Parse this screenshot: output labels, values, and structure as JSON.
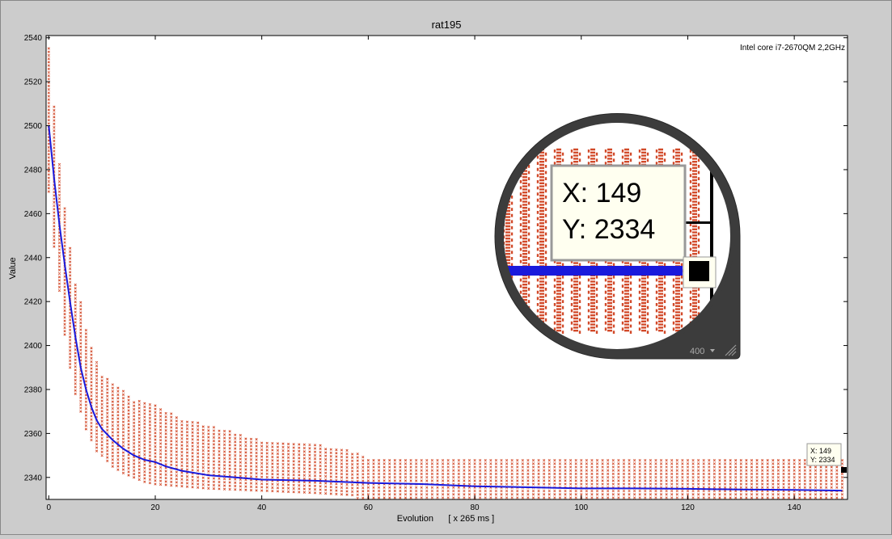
{
  "window": {
    "background": "#cccccc"
  },
  "annotation": {
    "text": "Intel core i7-2670QM 2,2GHz"
  },
  "datatip": {
    "x_label": "X: 149",
    "y_label": "Y: 2334"
  },
  "magnifier": {
    "x_label": "X: 149",
    "y_label": "Y: 2334",
    "zoom": "400"
  },
  "colors": {
    "mean_line": "#1a1adc",
    "samples": "#d24a2a",
    "axes": "#000000",
    "plot_bg": "#ffffff",
    "tip_bg": "#fffff0"
  },
  "chart_data": {
    "type": "scatter",
    "title": "rat195",
    "xlabel": "Evolution      [ x 265 ms ]",
    "ylabel": "Value",
    "xlim": [
      -0.5,
      150
    ],
    "ylim": [
      2330,
      2541
    ],
    "xticks": [
      0,
      20,
      40,
      60,
      80,
      100,
      120,
      140
    ],
    "yticks": [
      2340,
      2360,
      2380,
      2400,
      2420,
      2440,
      2460,
      2480,
      2500,
      2520,
      2540
    ],
    "grid": false,
    "series": [
      {
        "kind": "line",
        "x": [
          0,
          1,
          2,
          3,
          4,
          5,
          6,
          7,
          8,
          9,
          10,
          12,
          14,
          16,
          18,
          20,
          22,
          25,
          30,
          35,
          40,
          50,
          60,
          70,
          80,
          90,
          100,
          110,
          120,
          130,
          140,
          149
        ],
        "y": [
          2500,
          2476,
          2455,
          2437,
          2420,
          2404,
          2390,
          2380,
          2372,
          2366,
          2362,
          2357,
          2353,
          2350,
          2348,
          2347,
          2345,
          2343,
          2341,
          2340,
          2339,
          2338.5,
          2337.5,
          2337,
          2336,
          2335.5,
          2335,
          2335,
          2334.8,
          2334.5,
          2334.3,
          2334
        ]
      },
      {
        "kind": "band",
        "x": [
          0,
          1,
          2,
          3,
          4,
          5,
          6,
          7,
          8,
          9,
          10,
          12,
          14,
          16,
          18,
          20,
          25,
          30,
          40,
          50,
          57,
          60,
          80,
          100,
          120,
          140,
          149
        ],
        "ymin": [
          2470,
          2445,
          2425,
          2405,
          2390,
          2378,
          2370,
          2362,
          2357,
          2352,
          2350,
          2345,
          2342,
          2340,
          2338,
          2337,
          2336,
          2335,
          2334,
          2333,
          2332,
          2323,
          2323,
          2323,
          2323,
          2323,
          2323
        ],
        "ymax": [
          2536,
          2510,
          2483,
          2463,
          2445,
          2428,
          2420,
          2408,
          2400,
          2393,
          2387,
          2383,
          2380,
          2375,
          2375,
          2373,
          2367,
          2364,
          2357,
          2355,
          2352,
          2349,
          2349,
          2349,
          2349,
          2349,
          2349
        ]
      }
    ]
  }
}
